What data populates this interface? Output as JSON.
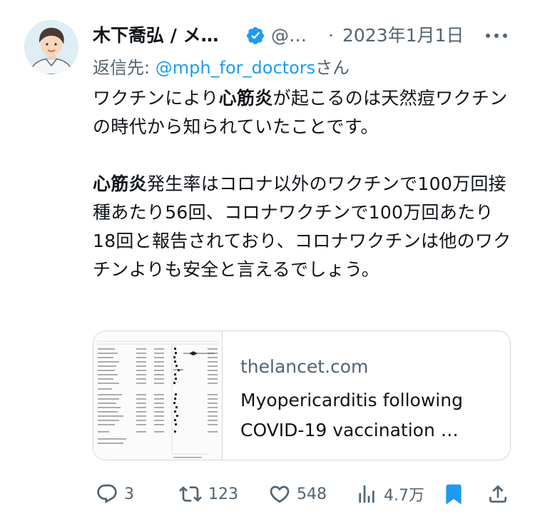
{
  "tweet": {
    "author_name": "木下喬弘 / メ…",
    "handle": "@…",
    "separator": "·",
    "date": "2023年1月1日",
    "reply_prefix": "返信先: ",
    "reply_handle": "@mph_for_doctors",
    "reply_suffix": "さん",
    "p1_part1": "ワクチンにより",
    "p1_bold": "心筋炎",
    "p1_part2": "が起こるのは天然痘ワクチンの時代から知られていたことです。",
    "p2_bold": "心筋炎",
    "p2_part": "発生率はコロナ以外のワクチンで100万回接種あたり56回、コロナワクチンで100万回あたり18回と報告されており、コロナワクチンは他のワクチンよりも安全と言えるでしょう。"
  },
  "card": {
    "domain": "thelancet.com",
    "title": "Myopericarditis following COVID-19 vaccination …"
  },
  "actions": {
    "replies": "3",
    "retweets": "123",
    "likes": "548",
    "views": "4.7万"
  },
  "colors": {
    "accent": "#1d9bf0",
    "secondary_text": "#536471",
    "primary_text": "#0f1419",
    "border": "#cfd9de"
  }
}
